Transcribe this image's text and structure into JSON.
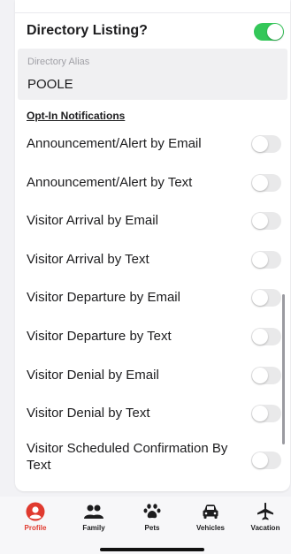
{
  "directory": {
    "label": "Directory Listing?",
    "enabled": true,
    "alias_label": "Directory Alias",
    "alias_value": "POOLE"
  },
  "notifications": {
    "title": "Opt-In Notifications",
    "items": [
      {
        "label": "Announcement/Alert by Email",
        "enabled": false
      },
      {
        "label": "Announcement/Alert by Text",
        "enabled": false
      },
      {
        "label": "Visitor Arrival by Email",
        "enabled": false
      },
      {
        "label": "Visitor Arrival by Text",
        "enabled": false
      },
      {
        "label": "Visitor Departure by Email",
        "enabled": false
      },
      {
        "label": "Visitor Departure by Text",
        "enabled": false
      },
      {
        "label": "Visitor Denial by Email",
        "enabled": false
      },
      {
        "label": "Visitor Denial by Text",
        "enabled": false
      },
      {
        "label": "Visitor Scheduled Confirmation By Text",
        "enabled": false
      }
    ]
  },
  "tabs": [
    {
      "label": "Profile",
      "icon": "profile-icon",
      "active": true
    },
    {
      "label": "Family",
      "icon": "family-icon",
      "active": false
    },
    {
      "label": "Pets",
      "icon": "paw-icon",
      "active": false
    },
    {
      "label": "Vehicles",
      "icon": "car-icon",
      "active": false
    },
    {
      "label": "Vacation",
      "icon": "airplane-icon",
      "active": false
    }
  ],
  "colors": {
    "toggle_on": "#34c759",
    "toggle_off": "#e9e9ea",
    "active_tab": "#e03a2f"
  }
}
